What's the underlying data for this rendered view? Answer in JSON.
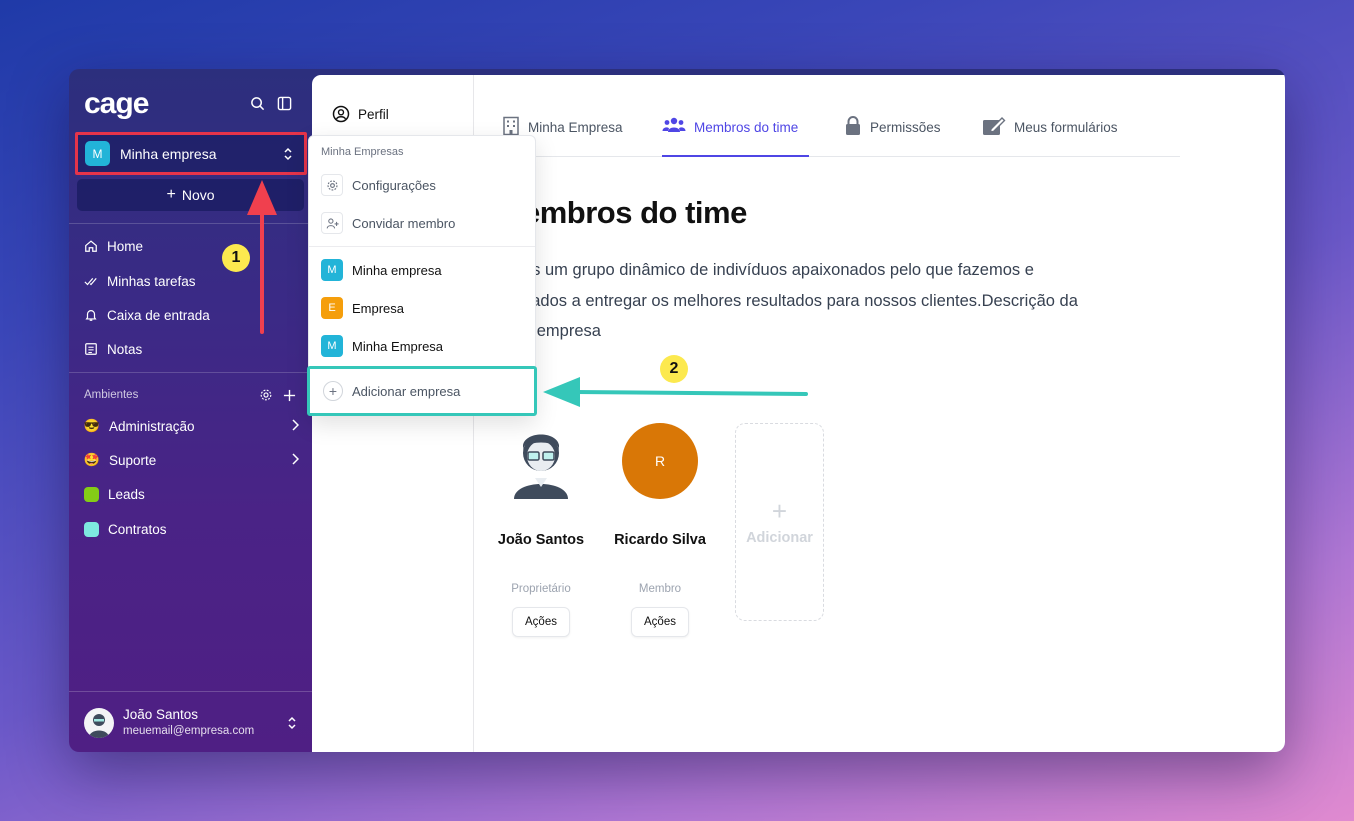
{
  "app": {
    "logo": "cage"
  },
  "sidebar": {
    "org": {
      "badge": "M",
      "name": "Minha empresa"
    },
    "new_button": "Novo",
    "nav": [
      {
        "label": "Home",
        "icon": "home-icon"
      },
      {
        "label": "Minhas tarefas",
        "icon": "check-double-icon"
      },
      {
        "label": "Caixa de entrada",
        "icon": "bell-icon"
      },
      {
        "label": "Notas",
        "icon": "notes-icon"
      }
    ],
    "section_label": "Ambientes",
    "environments": [
      {
        "label": "Administração",
        "emoji": "😎"
      },
      {
        "label": "Suporte",
        "emoji": "🤩"
      },
      {
        "label": "Leads",
        "color": "#84cc16"
      },
      {
        "label": "Contratos",
        "color": "#7ee8e0"
      }
    ],
    "user": {
      "name": "João Santos",
      "email": "meuemail@empresa.com"
    }
  },
  "settings_nav": {
    "perfil": "Perfil"
  },
  "tabs": [
    {
      "label": "Minha Empresa",
      "icon": "building-icon"
    },
    {
      "label": "Membros do time",
      "icon": "users-icon",
      "active": true
    },
    {
      "label": "Permissões",
      "icon": "lock-icon"
    },
    {
      "label": "Meus formulários",
      "icon": "edit-icon"
    }
  ],
  "main": {
    "heading": "embros do time",
    "description_lines": [
      "os um grupo dinâmico de indivíduos apaixonados pelo que fazemos e",
      "cados a entregar os melhores resultados para nossos clientes.Descrição da",
      "a empresa"
    ],
    "members": [
      {
        "name": "João Santos",
        "role": "Proprietário",
        "action": "Ações"
      },
      {
        "name": "Ricardo Silva",
        "role": "Membro",
        "action": "Ações",
        "initial": "R",
        "color": "#d97706"
      }
    ],
    "add_label": "Adicionar"
  },
  "dropdown": {
    "header": "Minha Empresas",
    "actions": [
      {
        "label": "Configurações",
        "icon": "gear-icon"
      },
      {
        "label": "Convidar membro",
        "icon": "user-plus-icon"
      }
    ],
    "companies": [
      {
        "badge": "M",
        "name": "Minha empresa",
        "color": "#22b4d8"
      },
      {
        "badge": "E",
        "name": "Empresa",
        "color": "#f59e0b"
      },
      {
        "badge": "M",
        "name": "Minha Empresa",
        "color": "#22b4d8"
      }
    ],
    "add_company": "Adicionar empresa"
  },
  "annotations": {
    "step1": "1",
    "step2": "2",
    "highlight_red": "#e5344a",
    "highlight_teal": "#35c7b9"
  }
}
